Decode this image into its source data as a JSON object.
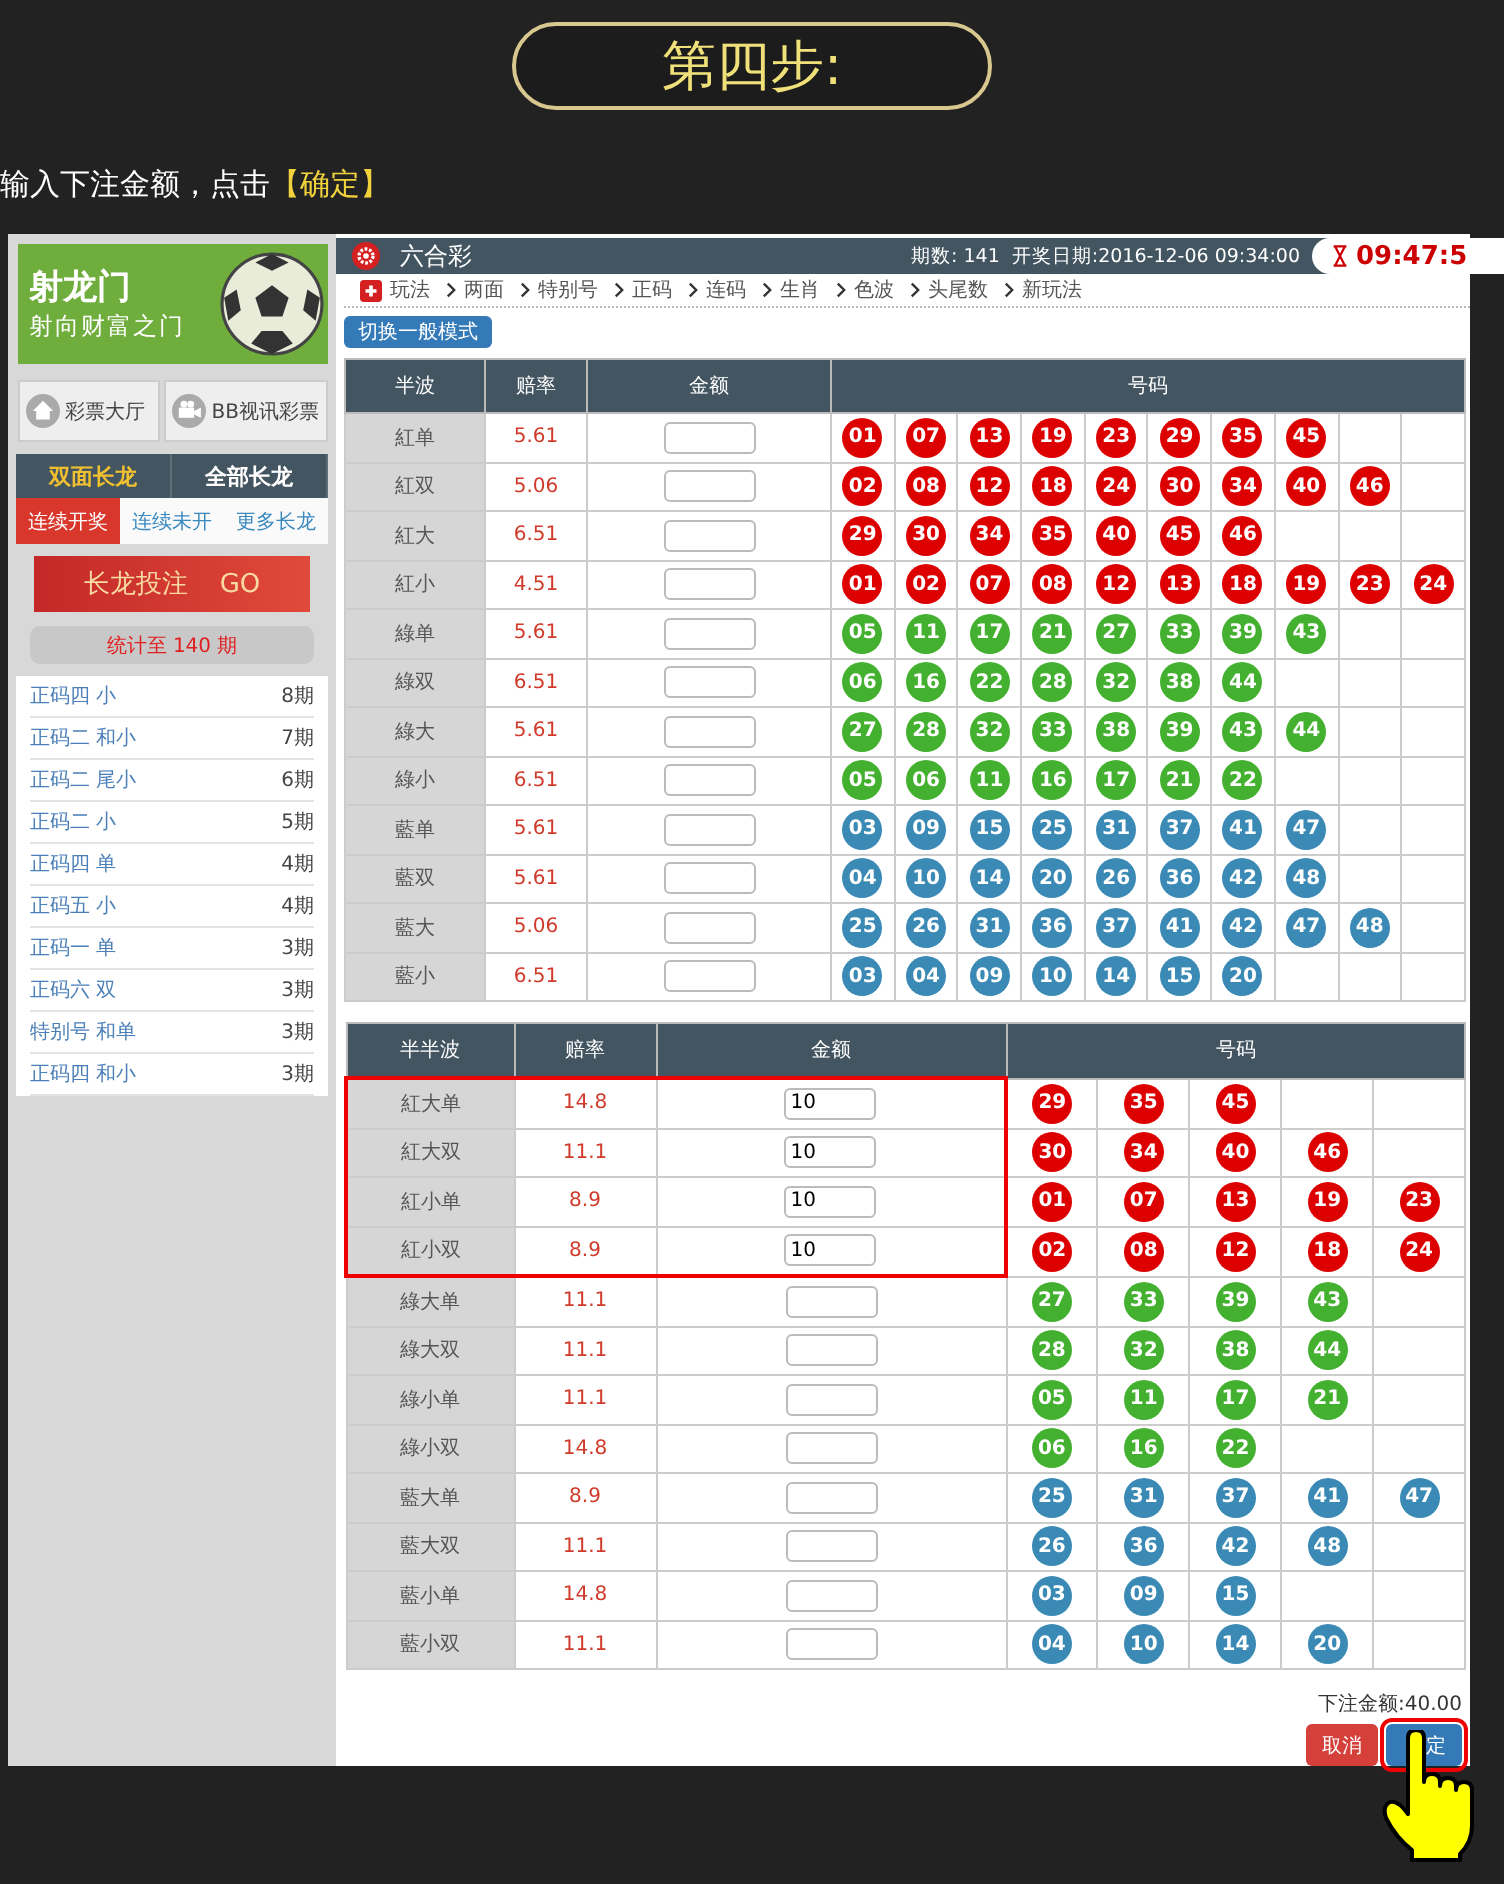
{
  "step_title": "第四步:",
  "instruction": {
    "text": "输入下注金额，点击",
    "highlight": "【确定】"
  },
  "sidebar": {
    "logo": {
      "name": "射龙门",
      "slogan": "射向财富之门"
    },
    "links": [
      {
        "label": "彩票大厅",
        "kind": "home"
      },
      {
        "label": "BB视讯彩票",
        "kind": "video"
      }
    ],
    "tabs": [
      {
        "label": "双面长龙",
        "selected": true
      },
      {
        "label": "全部长龙",
        "selected": false
      }
    ],
    "subtabs": [
      {
        "label": "连续开奖",
        "selected": true
      },
      {
        "label": "连续未开",
        "selected": false
      },
      {
        "label": "更多长龙",
        "selected": false
      }
    ],
    "banner": {
      "text": "长龙投注",
      "go": "GO"
    },
    "stats": "统计至 140 期",
    "streaks": [
      {
        "label": "正码四 小",
        "count": "8期"
      },
      {
        "label": "正码二 和小",
        "count": "7期"
      },
      {
        "label": "正码二 尾小",
        "count": "6期"
      },
      {
        "label": "正码二 小",
        "count": "5期"
      },
      {
        "label": "正码四 单",
        "count": "4期"
      },
      {
        "label": "正码五 小",
        "count": "4期"
      },
      {
        "label": "正码一 单",
        "count": "3期"
      },
      {
        "label": "正码六 双",
        "count": "3期"
      },
      {
        "label": "特别号 和单",
        "count": "3期"
      },
      {
        "label": "正码四 和小",
        "count": "3期"
      }
    ]
  },
  "header": {
    "title": "六合彩",
    "period": "期数: 141",
    "draw_date": "开奖日期:2016-12-06 09:34:00",
    "timer": "09:47:5"
  },
  "nav": [
    "玩法",
    "两面",
    "特别号",
    "正码",
    "连码",
    "生肖",
    "色波",
    "头尾数",
    "新玩法"
  ],
  "mode_button": "切换一般模式",
  "tables": [
    {
      "columns": [
        "半波",
        "赔率",
        "金额",
        "号码"
      ],
      "rows": [
        {
          "name": "紅单",
          "odds": "5.61",
          "color": "#dd0000",
          "numbers": [
            "01",
            "07",
            "13",
            "19",
            "23",
            "29",
            "35",
            "45"
          ]
        },
        {
          "name": "紅双",
          "odds": "5.06",
          "color": "#dd0000",
          "numbers": [
            "02",
            "08",
            "12",
            "18",
            "24",
            "30",
            "34",
            "40",
            "46"
          ]
        },
        {
          "name": "紅大",
          "odds": "6.51",
          "color": "#dd0000",
          "numbers": [
            "29",
            "30",
            "34",
            "35",
            "40",
            "45",
            "46"
          ]
        },
        {
          "name": "紅小",
          "odds": "4.51",
          "color": "#dd0000",
          "numbers": [
            "01",
            "02",
            "07",
            "08",
            "12",
            "13",
            "18",
            "19",
            "23",
            "24"
          ]
        },
        {
          "name": "綠单",
          "odds": "5.61",
          "color": "#44b030",
          "numbers": [
            "05",
            "11",
            "17",
            "21",
            "27",
            "33",
            "39",
            "43"
          ]
        },
        {
          "name": "綠双",
          "odds": "6.51",
          "color": "#44b030",
          "numbers": [
            "06",
            "16",
            "22",
            "28",
            "32",
            "38",
            "44"
          ]
        },
        {
          "name": "綠大",
          "odds": "5.61",
          "color": "#44b030",
          "numbers": [
            "27",
            "28",
            "32",
            "33",
            "38",
            "39",
            "43",
            "44"
          ]
        },
        {
          "name": "綠小",
          "odds": "6.51",
          "color": "#44b030",
          "numbers": [
            "05",
            "06",
            "11",
            "16",
            "17",
            "21",
            "22"
          ]
        },
        {
          "name": "藍单",
          "odds": "5.61",
          "color": "#3a8ab5",
          "numbers": [
            "03",
            "09",
            "15",
            "25",
            "31",
            "37",
            "41",
            "47"
          ]
        },
        {
          "name": "藍双",
          "odds": "5.61",
          "color": "#3a8ab5",
          "numbers": [
            "04",
            "10",
            "14",
            "20",
            "26",
            "36",
            "42",
            "48"
          ]
        },
        {
          "name": "藍大",
          "odds": "5.06",
          "color": "#3a8ab5",
          "numbers": [
            "25",
            "26",
            "31",
            "36",
            "37",
            "41",
            "42",
            "47",
            "48"
          ]
        },
        {
          "name": "藍小",
          "odds": "6.51",
          "color": "#3a8ab5",
          "numbers": [
            "03",
            "04",
            "09",
            "10",
            "14",
            "15",
            "20"
          ]
        }
      ]
    },
    {
      "columns": [
        "半半波",
        "赔率",
        "金额",
        "号码"
      ],
      "rows": [
        {
          "name": "紅大单",
          "odds": "14.8",
          "amount": "10",
          "highlighted": true,
          "color": "#dd0000",
          "numbers": [
            "29",
            "35",
            "45"
          ]
        },
        {
          "name": "紅大双",
          "odds": "11.1",
          "amount": "10",
          "highlighted": true,
          "color": "#dd0000",
          "numbers": [
            "30",
            "34",
            "40",
            "46"
          ]
        },
        {
          "name": "紅小单",
          "odds": "8.9",
          "amount": "10",
          "highlighted": true,
          "color": "#dd0000",
          "numbers": [
            "01",
            "07",
            "13",
            "19",
            "23"
          ]
        },
        {
          "name": "紅小双",
          "odds": "8.9",
          "amount": "10",
          "highlighted": true,
          "color": "#dd0000",
          "numbers": [
            "02",
            "08",
            "12",
            "18",
            "24"
          ]
        },
        {
          "name": "綠大单",
          "odds": "11.1",
          "highlighted": false,
          "color": "#44b030",
          "numbers": [
            "27",
            "33",
            "39",
            "43"
          ]
        },
        {
          "name": "綠大双",
          "odds": "11.1",
          "highlighted": false,
          "color": "#44b030",
          "numbers": [
            "28",
            "32",
            "38",
            "44"
          ]
        },
        {
          "name": "綠小单",
          "odds": "11.1",
          "highlighted": false,
          "color": "#44b030",
          "numbers": [
            "05",
            "11",
            "17",
            "21"
          ]
        },
        {
          "name": "綠小双",
          "odds": "14.8",
          "highlighted": false,
          "color": "#44b030",
          "numbers": [
            "06",
            "16",
            "22"
          ]
        },
        {
          "name": "藍大单",
          "odds": "8.9",
          "highlighted": false,
          "color": "#3a8ab5",
          "numbers": [
            "25",
            "31",
            "37",
            "41",
            "47"
          ]
        },
        {
          "name": "藍大双",
          "odds": "11.1",
          "highlighted": false,
          "color": "#3a8ab5",
          "numbers": [
            "26",
            "36",
            "42",
            "48"
          ]
        },
        {
          "name": "藍小单",
          "odds": "14.8",
          "highlighted": false,
          "color": "#3a8ab5",
          "numbers": [
            "03",
            "09",
            "15"
          ]
        },
        {
          "name": "藍小双",
          "odds": "11.1",
          "highlighted": false,
          "color": "#3a8ab5",
          "numbers": [
            "04",
            "10",
            "14",
            "20"
          ]
        }
      ]
    }
  ],
  "total": "下注金额:40.00",
  "buttons": [
    {
      "label": "取消",
      "kind": "cancel",
      "highlighted": false
    },
    {
      "label": "定",
      "kind": "confirm",
      "highlighted": true
    }
  ]
}
